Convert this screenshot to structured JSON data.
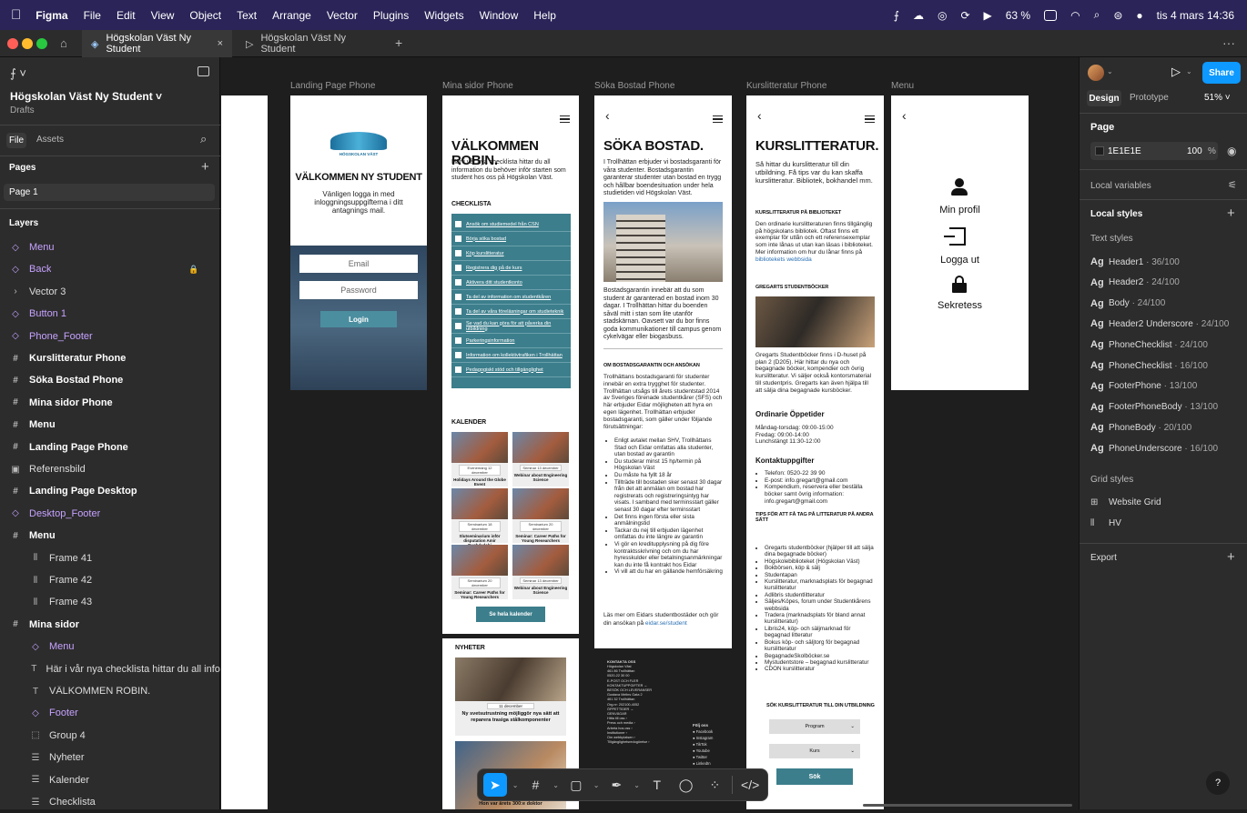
{
  "menubar": {
    "app": "Figma",
    "items": [
      "File",
      "Edit",
      "View",
      "Object",
      "Text",
      "Arrange",
      "Vector",
      "Plugins",
      "Widgets",
      "Window",
      "Help"
    ],
    "battery": "63 %",
    "clock": "tis 4 mars 14:36"
  },
  "tabs": [
    {
      "label": "Högskolan Väst Ny Student",
      "icon": "figma-file-icon",
      "close": "×"
    },
    {
      "label": "Högskolan Väst Ny Student",
      "icon": "play-icon"
    }
  ],
  "leftpanel": {
    "file_name": "Högskolan Väst Ny Student",
    "location": "Drafts",
    "tab_file": "File",
    "tab_assets": "Assets",
    "pages_title": "Pages",
    "page1": "Page 1",
    "layers_title": "Layers",
    "layers": [
      {
        "label": "Menu",
        "glyph": "◇",
        "style": "purple",
        "indent": 0
      },
      {
        "label": "Back",
        "glyph": "◇",
        "style": "purple",
        "indent": 0,
        "lock": true
      },
      {
        "label": "Vector 3",
        "glyph": "›",
        "style": "",
        "indent": 0
      },
      {
        "label": "Button 1",
        "glyph": "◇",
        "style": "purple",
        "indent": 0
      },
      {
        "label": "Phone_Footer",
        "glyph": "◇",
        "style": "purple",
        "indent": 0
      },
      {
        "label": "Kurslitteratur Phone",
        "glyph": "#",
        "style": "bold",
        "indent": 0
      },
      {
        "label": "Söka Bostad Phone",
        "glyph": "#",
        "style": "bold",
        "indent": 0
      },
      {
        "label": "Mina sidor Phone",
        "glyph": "#",
        "style": "bold",
        "indent": 0
      },
      {
        "label": "Menu",
        "glyph": "#",
        "style": "bold",
        "indent": 0
      },
      {
        "label": "Landing Page Phone",
        "glyph": "#",
        "style": "bold",
        "indent": 0
      },
      {
        "label": "Referensbild",
        "glyph": "▣",
        "style": "",
        "indent": 0
      },
      {
        "label": "Landing Page Desktop",
        "glyph": "#",
        "style": "bold",
        "indent": 0
      },
      {
        "label": "Desktop_Footer",
        "glyph": "◇",
        "style": "purple",
        "indent": 0
      },
      {
        "label": "Menu",
        "glyph": "#",
        "style": "bold",
        "indent": 0
      },
      {
        "label": "Frame 41",
        "glyph": "⫴",
        "style": "",
        "indent": 1
      },
      {
        "label": "Frame 42",
        "glyph": "⫴",
        "style": "",
        "indent": 1
      },
      {
        "label": "Frame 43",
        "glyph": "⫴",
        "style": "",
        "indent": 1
      },
      {
        "label": "Mina sidor",
        "glyph": "#",
        "style": "bold",
        "indent": 0
      },
      {
        "label": "Menu",
        "glyph": "◇",
        "style": "purple",
        "indent": 1
      },
      {
        "label": "Här i vår nya checklista hittar du all information d",
        "glyph": "T",
        "style": "",
        "indent": 1
      },
      {
        "label": "VÄLKOMMEN ROBIN.",
        "glyph": "T",
        "style": "",
        "indent": 1
      },
      {
        "label": "Footer",
        "glyph": "◇",
        "style": "purple",
        "indent": 1
      },
      {
        "label": "Group 4",
        "glyph": "⬚",
        "style": "",
        "indent": 1
      },
      {
        "label": "Nyheter",
        "glyph": "☰",
        "style": "",
        "indent": 1
      },
      {
        "label": "Kalender",
        "glyph": "☰",
        "style": "",
        "indent": 1
      },
      {
        "label": "Checklista",
        "glyph": "☰",
        "style": "",
        "indent": 1
      }
    ]
  },
  "rightpanel": {
    "share": "Share",
    "tab_design": "Design",
    "tab_prototype": "Prototype",
    "zoom": "51%",
    "page_title": "Page",
    "page_color": "1E1E1E",
    "page_opacity": "100",
    "pct": "%",
    "local_variables": "Local variables",
    "local_styles": "Local styles",
    "text_styles": "Text styles",
    "styles": [
      {
        "name": "Header1",
        "meta": " · 36/100"
      },
      {
        "name": "Header2",
        "meta": " · 24/100"
      },
      {
        "name": "Body",
        "meta": " · 24/100"
      },
      {
        "name": "Header2 Underscore",
        "meta": " · 24/100"
      },
      {
        "name": "PhoneChecklist",
        "meta": " · 24/100"
      },
      {
        "name": "PhoneChecklist",
        "meta": " · 16/100"
      },
      {
        "name": "FooterPhone",
        "meta": " · 13/100"
      },
      {
        "name": "FooterPhoneBody",
        "meta": " · 13/100"
      },
      {
        "name": "PhoneBody",
        "meta": " · 20/100"
      },
      {
        "name": "PhoneUnderscore",
        "meta": " · 16/100"
      }
    ],
    "grid_styles": "Grid styles",
    "grids": [
      "Website Grid",
      "HV"
    ],
    "export": "Export",
    "help": "?"
  },
  "frames": {
    "landing": {
      "label": "Landing Page Phone",
      "logo_text": "HÖGSKOLAN VÄST",
      "title": "VÄLKOMMEN NY STUDENT",
      "sub": "Vänligen logga in med inloggningsuppgifterna i ditt antagnings mail.",
      "email": "Email",
      "password": "Password",
      "login": "Login"
    },
    "mina": {
      "label": "Mina sidor Phone",
      "title": "VÄLKOMMEN ROBIN.",
      "intro": "Här i vår nya checklista hittar du all information du behöver inför starten som student hos oss på Högskolan Väst.",
      "checklist_title": "CHECKLISTA",
      "checklist": [
        "Ansök om studiemedel från CSN",
        "Börja söka bostad",
        "Köp kurslitteratur",
        "Registrera dig på de kurs",
        "Aktivera ditt studentkonto",
        "Ta del av information om studentkåren",
        "Ta del av våra föreläsningar om studieteknik",
        "Se vad du kan göra för att påverka din utbildning",
        "Parkeringsinformation",
        "Information om kollektivtrafiken i Trollhättan",
        "Pedagogiskt stöd och tillgänglighet"
      ],
      "calendar_title": "KALENDER",
      "events": [
        {
          "date": "Evenemang 12 december",
          "title": "Holidays Around the Globe Event"
        },
        {
          "date": "Seminar 13 december",
          "title": "Webinar about Engineering Science"
        },
        {
          "date": "Seminarium 18 december",
          "title": "Slutseminarium inför disputation Amir Baghdadchi"
        },
        {
          "date": "Seminarium 20 december",
          "title": "Seminar: Career Paths for Young Researchers"
        },
        {
          "date": "Seminarium 20 december",
          "title": "Seminar: Career Paths for Young Researchers"
        },
        {
          "date": "Seminar 13 december",
          "title": "Webinar about Engineering Science"
        }
      ],
      "calendar_btn": "Se hela kalender",
      "news_title": "NYHETER",
      "news_date": "11 december",
      "news_text": "Ny svetsutrustning möjliggör nya sätt att reparera trasiga stålkomponenter",
      "news2": "Hon var årets 300:e doktor"
    },
    "bostad": {
      "label": "Söka Bostad Phone",
      "back": "‹",
      "title": "SÖKA BOSTAD.",
      "intro": "I Trollhättan erbjuder vi bostadsgaranti för våra studenter. Bostadsgarantin garanterar studenter utan bostad en trygg och hållbar boendesituation under hela studietiden vid Högskolan Väst.",
      "p2": "Bostadsgarantin innebär att du som student är garanterad en bostad inom 30 dagar. I Trollhättan hittar du boenden såväl mitt i stan som lite utanför stadskärnan. Oavsett var du bor finns goda kommunikationer till campus genom cykelvägar eller biogasbuss.",
      "h2": "OM BOSTADSGARANTIN OCH ANSÖKAN",
      "p3": "Trollhättans bostadsgaranti för studenter innebär en extra trygghet för studenter. Trollhättan utsågs till årets studentstad 2014 av Sveriges förenade studentkårer (SFS) och här erbjuder Eidar möjligheten att hyra en egen lägenhet. Trollhättan erbjuder bostadsgaranti, som gäller under följande förutsättningar:",
      "bullets": [
        "Enligt avtalet mellan SHV, Trollhättans Stad och Eidar omfattas alla studenter, utan bostad av garantin",
        "Du studerar minst 15 hp/termin på Högskolan Väst",
        "Du måste ha fyllt 18 år",
        "Tillträde till bostaden sker senast 30 dagar från det att anmälan om bostad har registrerats och registreringsintyg har visats. I samband med terminsstart gäller senast 30 dagar efter terminsstart",
        "Det finns ingen första eller sista anmälningstid",
        "Tackar du nej till erbjuden lägenhet omfattas du inte längre av garantin",
        "Vi gör en kreditupplysning på dig före kontraktsskrivning och om du har hyresskulder eller betalningsanmärkningar kan du inte få kontrakt hos Eidar",
        "Vi vill att du har en gällande hemförsäkring"
      ],
      "outro": "Läs mer om Eidars studentbostäder och gör din ansökan på ",
      "link": "eidar.se/student",
      "footer_contact": "KONTAKTA OSS",
      "footer_lines": [
        "Högskolan Väst",
        "461 86 Trollhättan",
        "0520-22 30 00",
        "E-POST OCH FLER KONTAKTUPPGIFTER →",
        "BESÖK OCH LEVERANSER",
        "Gustava Melins Gata 2",
        "461 32 Trollhättan",
        "Org.nr: 202100-4052",
        "ÖPPETTIDER →",
        "GENVÄGAR",
        "Hitta till oss ›",
        "Press och media ›",
        "Arbeta hos oss ›",
        "Institutioner ›",
        "Om webbplatsen ›",
        "Tillgänglighetsredogörelse ›"
      ],
      "follow": "Följ oss",
      "social": [
        "Facebook",
        "Instagram",
        "TikTok",
        "Youtube",
        "Twitter",
        "LinkedIn"
      ]
    },
    "kurs": {
      "label": "Kurslitteratur Phone",
      "title": "KURSLITTERATUR.",
      "intro": "Så hittar du kurslitteratur till din utbildning. Få tips var du kan skaffa kurslitteratur. Bibliotek, bokhandel mm.",
      "h_bib": "KURSLITTERATUR PÅ BIBLIOTEKET",
      "p_bib": "Den ordinarie kurslitteraturen finns tillgänglig på högskolans bibliotek. Oftast finns ett exemplar för utlån och ett referensexemplar som inte lånas ut utan kan läsas i biblioteket. Mer information om hur du lånar finns på ",
      "p_bib_link": "bibliotekets webbsida",
      "h_greg": "GREGARTS STUDENTBÖCKER",
      "p_greg": "Gregarts Studentböcker finns i D-huset på plan 2 (D205). Här hittar du nya och begagnade böcker, kompendier och övrig kurslitteratur. Vi säljer också kontorsmaterial till studentpris. Gregarts kan även hjälpa till att sälja dina begagnade kursböcker.",
      "h_open": "Ordinarie Öppetider",
      "open": "Måndag-torsdag: 09:00-15:00\nFredag: 09:00-14:00\nLunchstängt 11:30-12:00",
      "h_contact": "Kontaktuppgifter",
      "contact": [
        "Telefon: 0520-22 39 90",
        "E-post: info.gregart@gmail.com",
        "Kompendium, reservera eller beställa böcker samt övrig information: info.gregart@gmail.com"
      ],
      "h_tips": "TIPS FÖR ATT FÅ TAG PÅ LITTERATUR PÅ ANDRA SÄTT",
      "tips": [
        "Gregarts studentböcker (hjälper till att sälja dina begagnade böcker)",
        "Högskolebiblioteket (Högskolan Väst)",
        "Bokbörsen, köp & sälj",
        "Studentapan",
        "Kurslitteratur, marknadsplats för begagnad kurslitteratur",
        "Adlibris studentlitteratur",
        "Säljes/Köpes, forum under Studentkårens webbsida",
        "Tradera (marknadsplats för bland annat kurslitteratur)",
        "Libris24, köp- och säljmarknad för begagnad litteratur",
        "Bokus köp- och säljtorg för begagnad kurslitteratur",
        "BegagnadeSkolböcker.se",
        "Mystudentstore – begagnad kurslitteratur",
        "CDON kurslitteratur"
      ],
      "h_search": "SÖK KURSLITTERATUR TILL DIN UTBILDNING",
      "sel1": "Program",
      "sel2": "Kurs",
      "search_btn": "Sök"
    },
    "menu": {
      "label": "Menu",
      "items": [
        "Min profil",
        "Logga ut",
        "Sekretess"
      ]
    }
  },
  "colors": {
    "teal": "#3c7e8c",
    "accent": "#0d99ff",
    "layer_component": "#c6a2ff"
  }
}
